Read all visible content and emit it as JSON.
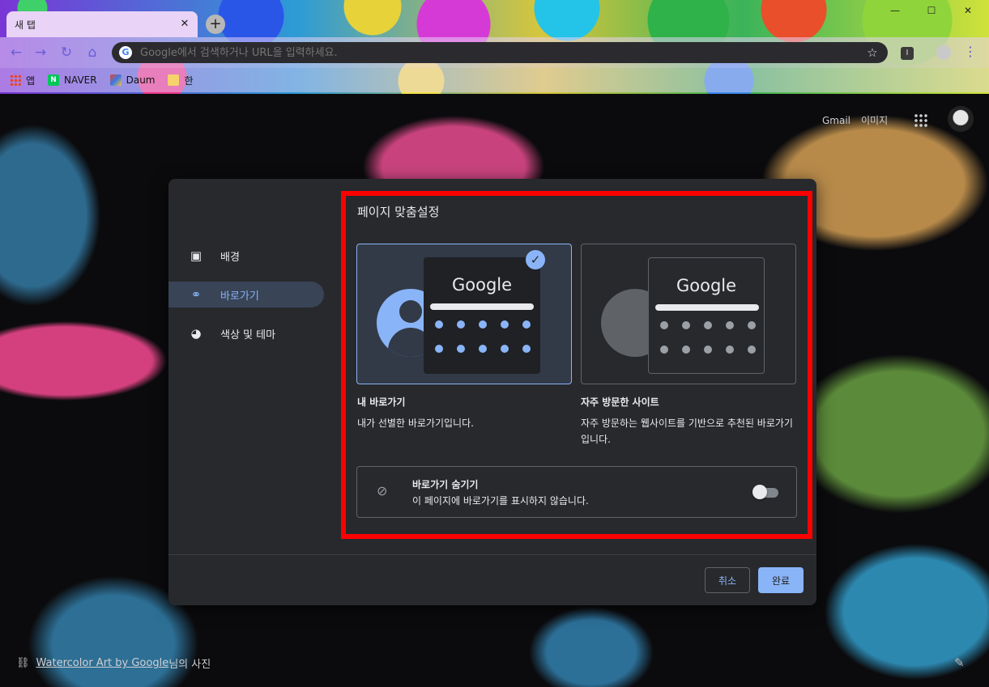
{
  "browser": {
    "tab_title": "새 탭",
    "tab_close": "✕",
    "new_tab": "+",
    "window_controls": [
      "—",
      "☐",
      "✕"
    ],
    "omnibox_placeholder": "Google에서 검색하거나 URL을 입력하세요.",
    "bookmarks": [
      "앱",
      "NAVER",
      "Daum",
      "한"
    ]
  },
  "ntp": {
    "gmail": "Gmail",
    "images": "이미지",
    "credit_link": "Watercolor Art by Google",
    "credit_suffix": "님의 사진"
  },
  "dialog": {
    "title": "페이지 맞춤설정",
    "sidebar": [
      {
        "label": "배경",
        "icon": "image-icon",
        "active": false
      },
      {
        "label": "바로가기",
        "icon": "link-icon",
        "active": true
      },
      {
        "label": "색상 및 테마",
        "icon": "palette-icon",
        "active": false
      }
    ],
    "options": [
      {
        "preview_logo": "Google",
        "title": "내 바로가기",
        "desc": "내가 선별한 바로가기입니다.",
        "selected": true
      },
      {
        "preview_logo": "Google",
        "title": "자주 방문한 사이트",
        "desc": "자주 방문하는 웹사이트를 기반으로 추천된 바로가기입니다.",
        "selected": false
      }
    ],
    "hide": {
      "title": "바로가기 숨기기",
      "desc": "이 페이지에 바로가기를 표시하지 않습니다.",
      "enabled": false
    },
    "cancel_label": "취소",
    "done_label": "완료"
  },
  "colors": {
    "accent": "#8ab4f8",
    "dialog_bg": "#28292d",
    "highlight_frame": "#ff0000"
  }
}
